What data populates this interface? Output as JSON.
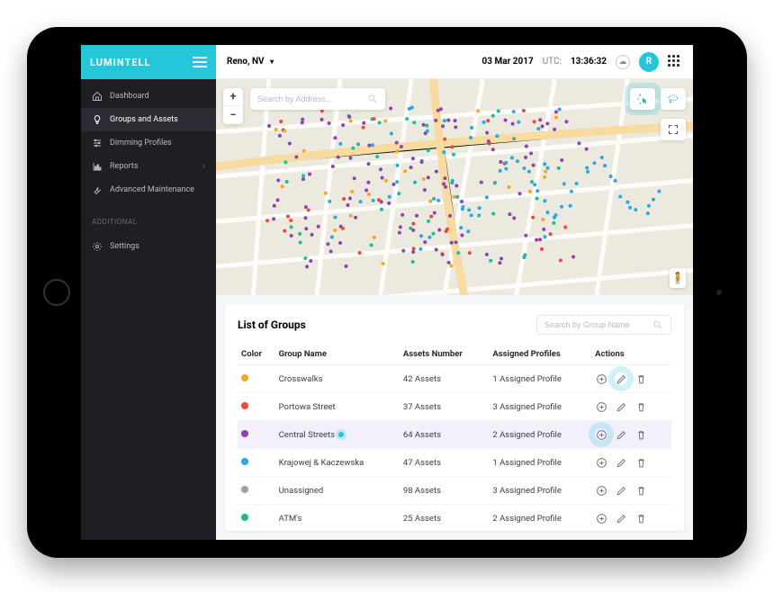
{
  "brand": "LUMINTELL",
  "header": {
    "location": "Reno, NV",
    "date": "03 Mar 2017",
    "utc_label": "UTC:",
    "utc_time": "13:36:32",
    "avatar_initial": "R"
  },
  "sidebar": {
    "items": [
      {
        "icon": "home",
        "label": "Dashboard"
      },
      {
        "icon": "bulb",
        "label": "Groups and Assets",
        "active": true
      },
      {
        "icon": "sliders",
        "label": "Dimming Profiles"
      },
      {
        "icon": "chart",
        "label": "Reports",
        "chevron": true
      },
      {
        "icon": "wrench",
        "label": "Advanced Maintenance"
      }
    ],
    "section_label": "ADDITIONAL",
    "extra": [
      {
        "icon": "gear",
        "label": "Settings"
      }
    ]
  },
  "map": {
    "search_placeholder": "Search by Address..."
  },
  "panel": {
    "title": "List of Groups",
    "search_placeholder": "Search by Group Name",
    "columns": [
      "Color",
      "Group Name",
      "Assets Number",
      "Assigned Profiles",
      "Actions"
    ],
    "rows": [
      {
        "color": "#f5a623",
        "name": "Crosswalks",
        "assets": "42 Assets",
        "profiles": "1 Assigned Profile",
        "highlight_edit": true
      },
      {
        "color": "#e74c3c",
        "name": "Portowa Street",
        "assets": "37 Assets",
        "profiles": "3 Assigned Profile"
      },
      {
        "color": "#8e44ad",
        "name": "Central Streets",
        "assets": "64 Assets",
        "profiles": "2 Assigned Profile",
        "pulse": true,
        "highlight_add": true,
        "selected": true
      },
      {
        "color": "#2aa8e0",
        "name": "Krajowej & Kaczewska",
        "assets": "47 Assets",
        "profiles": "1 Assigned Profile"
      },
      {
        "color": "#95a5a6",
        "name": "Unassigned",
        "assets": "98 Assets",
        "profiles": "3 Assigned Profile"
      },
      {
        "color": "#1abc9c",
        "name": "ATM's",
        "assets": "25 Assets",
        "profiles": "2 Assigned Profile"
      }
    ]
  }
}
